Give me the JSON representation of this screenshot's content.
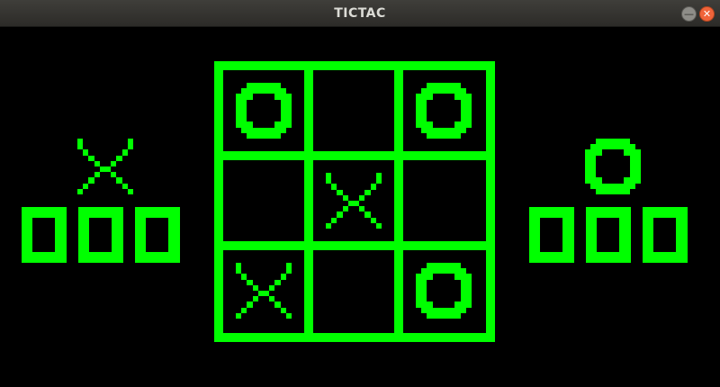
{
  "window": {
    "title": "TICTAC"
  },
  "colors": {
    "accent": "#00ff00",
    "background": "#000000",
    "titlebar": "#353431",
    "close": "#f0643a"
  },
  "board": {
    "cells": [
      "O",
      "",
      "O",
      "",
      "X",
      "",
      "X",
      "",
      "O"
    ]
  },
  "left_panel": {
    "player": "X",
    "score": "000"
  },
  "right_panel": {
    "player": "O",
    "score": "000"
  },
  "icons": {
    "minimize": "minimize-icon",
    "close": "close-icon"
  }
}
